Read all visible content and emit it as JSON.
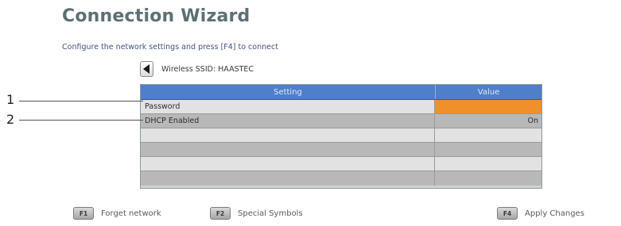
{
  "title": "Connection Wizard",
  "instructions": "Configure the network settings and press [F4] to connect",
  "ssid_label": "Wireless SSID: HAASTEC",
  "table": {
    "headers": {
      "setting": "Setting",
      "value": "Value"
    },
    "rows": [
      {
        "setting": "Password",
        "value": ""
      },
      {
        "setting": "DHCP Enabled",
        "value": "On"
      },
      {
        "setting": "",
        "value": ""
      },
      {
        "setting": "",
        "value": ""
      },
      {
        "setting": "",
        "value": ""
      },
      {
        "setting": "",
        "value": ""
      }
    ]
  },
  "callouts": [
    "1",
    "2"
  ],
  "footer": {
    "f1_key": "F1",
    "f1_label": "Forget network",
    "f2_key": "F2",
    "f2_label": "Special Symbols",
    "f4_key": "F4",
    "f4_label": "Apply Changes"
  },
  "icons": {
    "left": "left-arrow-icon"
  },
  "colors": {
    "header_blue": "#4f7fc9",
    "active_orange": "#f0902a",
    "title_gray": "#5d6f73",
    "instruction_blue": "#45527f"
  }
}
